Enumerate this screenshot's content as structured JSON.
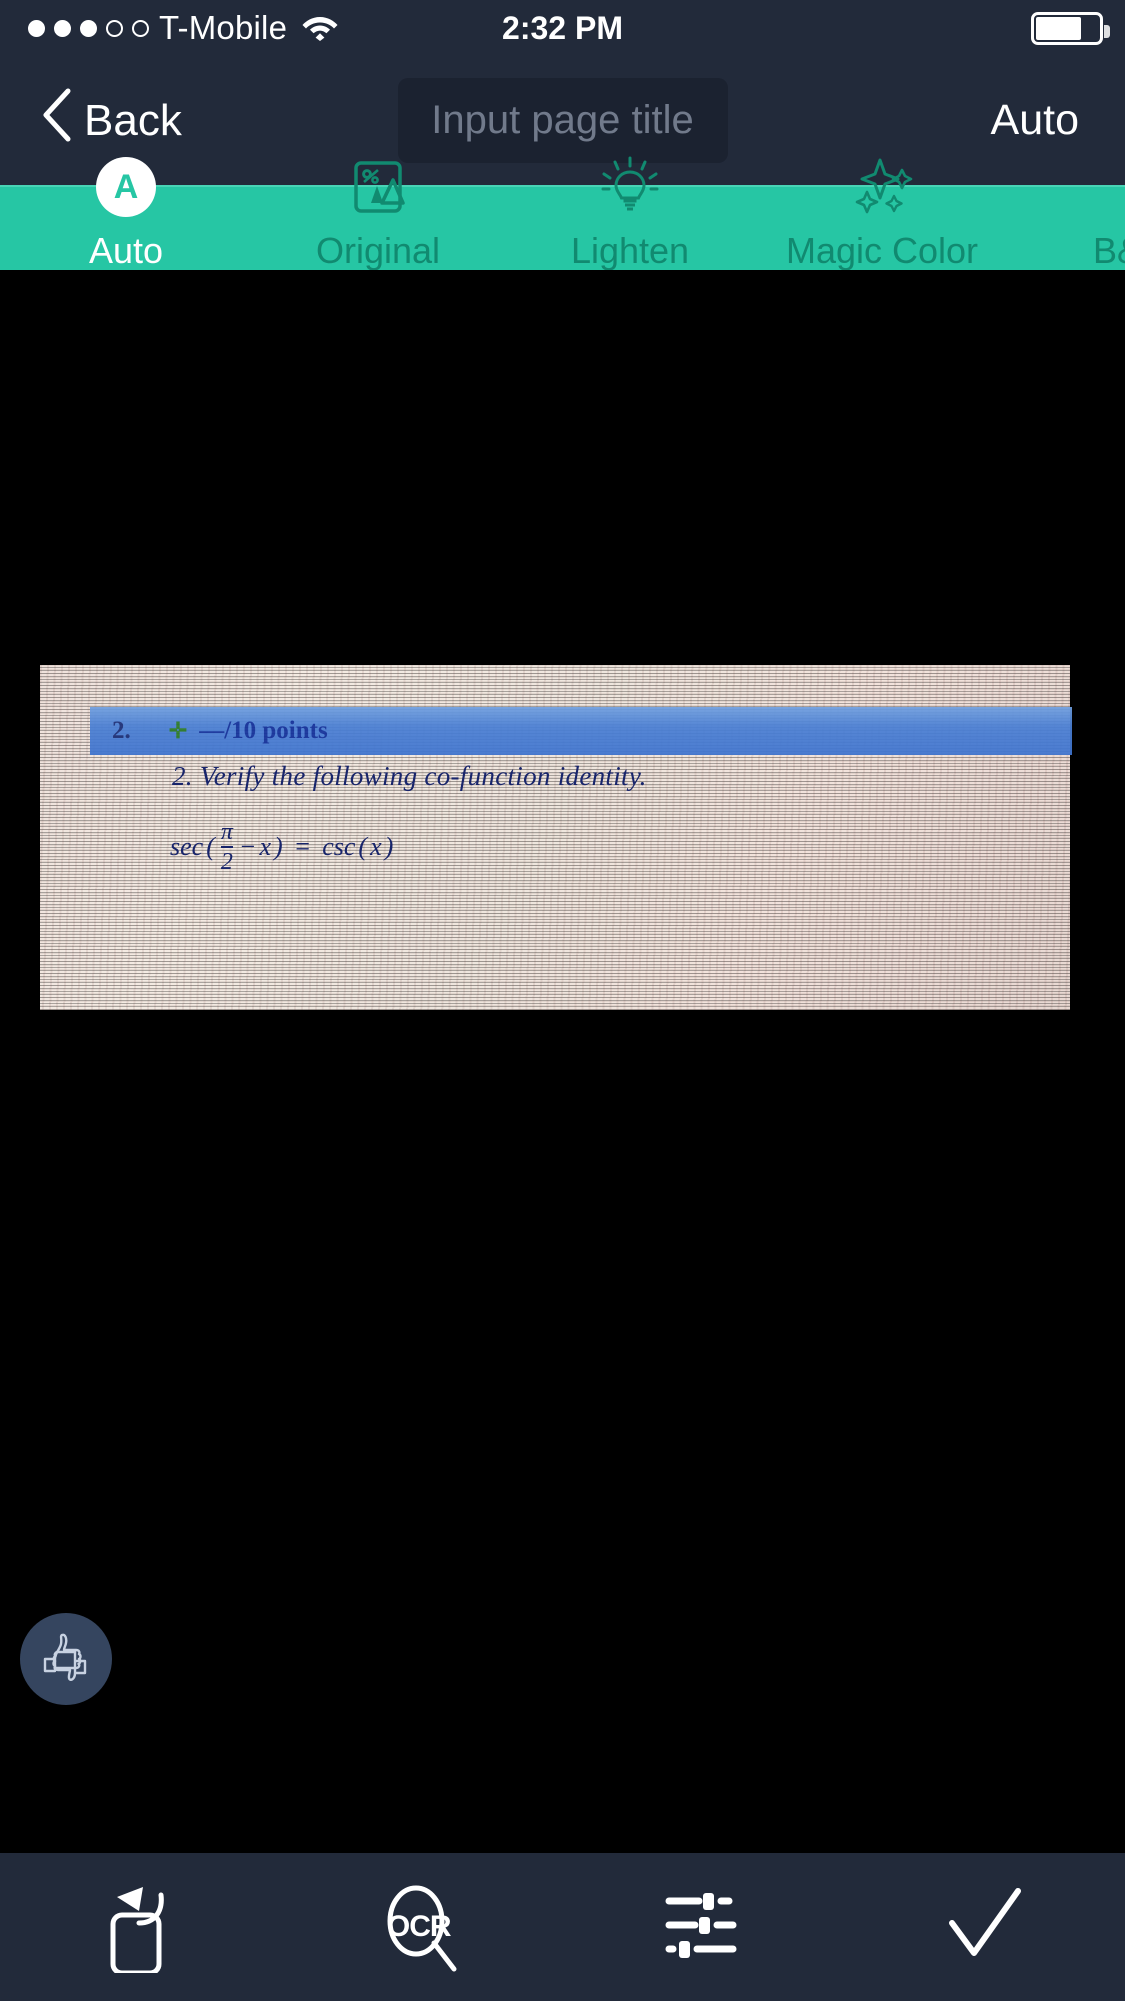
{
  "status_bar": {
    "carrier": "T-Mobile",
    "signal_dots_filled": 3,
    "signal_dots_total": 5,
    "wifi_icon": "wifi-icon",
    "time": "2:32 PM",
    "battery_icon": "battery-icon",
    "battery_percent": 72
  },
  "nav_bar": {
    "back_label": "Back",
    "back_icon": "chevron-left-icon",
    "title_placeholder": "Input page title",
    "title_value": "",
    "right_action_label": "Auto"
  },
  "filter_bar": {
    "accent_color": "#26c6a4",
    "label_color": "#118a70",
    "active_label_color": "#ffffff",
    "selected": "Auto",
    "items": [
      {
        "label": "Auto",
        "icon": "auto-badge-icon",
        "badge_letter": "A"
      },
      {
        "label": "Original",
        "icon": "original-image-icon"
      },
      {
        "label": "Lighten",
        "icon": "lightbulb-icon"
      },
      {
        "label": "Magic Color",
        "icon": "sparkles-icon"
      },
      {
        "label": "B&W",
        "icon": "bw-diamond-icon"
      }
    ]
  },
  "page_preview": {
    "background_color": "#000000",
    "scan": {
      "highlight_row": {
        "number": "2.",
        "mark": "✛",
        "points": "—/10 points",
        "highlight_color": "#4a7fd4",
        "text_color": "#12309c"
      },
      "question_text": "2. Verify the following co-function identity.",
      "equation": {
        "left_function": "sec",
        "numerator": "π",
        "denominator": "2",
        "operator": "−",
        "variable": "x",
        "equals": "=",
        "right_function": "csc",
        "right_argument": "x",
        "plain": "sec(π/2 − x) = csc(x)"
      },
      "ink_color": "#17246b"
    }
  },
  "feedback_fab": {
    "icon": "thumbs-up-down-icon",
    "background_color": "#35455f"
  },
  "bottom_bar": {
    "background_color": "#222a3a",
    "items": [
      {
        "icon": "rotate-icon",
        "label": "Rotate"
      },
      {
        "icon": "ocr-icon",
        "label": "OCR"
      },
      {
        "icon": "adjust-icon",
        "label": "Adjust"
      },
      {
        "icon": "checkmark-icon",
        "label": "Done"
      }
    ],
    "ocr_text": "OCR"
  }
}
